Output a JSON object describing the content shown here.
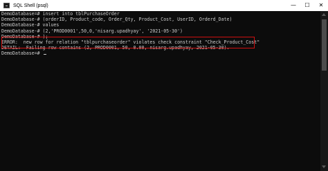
{
  "window": {
    "title": "SQL Shell (psql)",
    "controls": {
      "minimize": "—",
      "maximize": "☐",
      "close": "✕"
    }
  },
  "terminal": {
    "lines": [
      "DemoDatabase=# insert into tblPurchaseOrder",
      "DemoDatabase-# (orderID, Product_code, Order_Qty, Product_Cost, UserID, Orderd_Date)",
      "DemoDatabase-# values",
      "DemoDatabase-# (2,'PROD0001',50,0,'nisarg.upadhyay', '2021-05-30')",
      "DemoDatabase-# );",
      "ERROR:  new row for relation \"tblpurchaseorder\" violates check constraint \"Check_Product_Cost\"",
      "DETAIL:  Failing row contains (2, PROD0001, 50, 0.00, nisarg.upadhyay, 2021-05-30).",
      "DemoDatabase=# "
    ]
  },
  "colors": {
    "background": "#0c0c0c",
    "text": "#cccccc",
    "highlight_border": "#d11010"
  }
}
